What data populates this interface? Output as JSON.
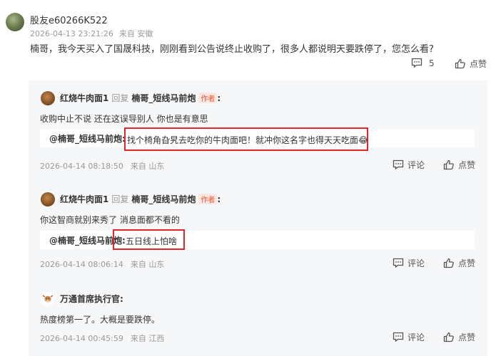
{
  "post": {
    "username": "股友e60266K522",
    "time": "2026-04-13 23:21:26",
    "location": "来自 安徽",
    "text": "楠哥，我今天买入了国晟科技，刚刚看到公告说终止收购了，很多人都说明天要跌停了，您怎么看?",
    "comment_count": "5",
    "like_label": "点赞"
  },
  "replies": [
    {
      "author": "红烧牛肉面1",
      "reply_word": "回复",
      "target": "楠哥_短线马前炮",
      "badge": "作者",
      "colon": ":",
      "text": "收购中止不说 还在这误导别人 你也是有意思",
      "quote_name": "@楠哥_短线马前炮:",
      "quote_text": "找个椅角旮旯去吃你的牛肉面吧！就冲你这名字也得天天吃面😂",
      "time": "2026-04-14 08:18:50",
      "location": "来自 山东",
      "comment_label": "评论",
      "like_label": "点赞"
    },
    {
      "author": "红烧牛肉面1",
      "reply_word": "回复",
      "target": "楠哥_短线马前炮",
      "badge": "作者",
      "colon": ":",
      "text": "你这智商就别来秀了 消息面都不看的",
      "quote_name": "@楠哥_短线马前炮:",
      "quote_text": "五日线上怕啥",
      "time": "2026-04-14 08:06:14",
      "location": "来自 山东",
      "comment_label": "评论",
      "like_label": "点赞"
    },
    {
      "author": "万通首席执行官:",
      "text": "热度榜第一了。大概是要跌停。",
      "time": "2026-04-14 00:45:59",
      "location": "来自 江西",
      "comment_label": "评论",
      "like_label": "点赞"
    }
  ],
  "colors": {
    "highlight_border": "#e2262c",
    "author_badge": "#f0542d",
    "reply_bg": "#f6f7f8"
  },
  "icons": [
    "comment-icon",
    "thumb-up-icon",
    "avatar-image"
  ]
}
